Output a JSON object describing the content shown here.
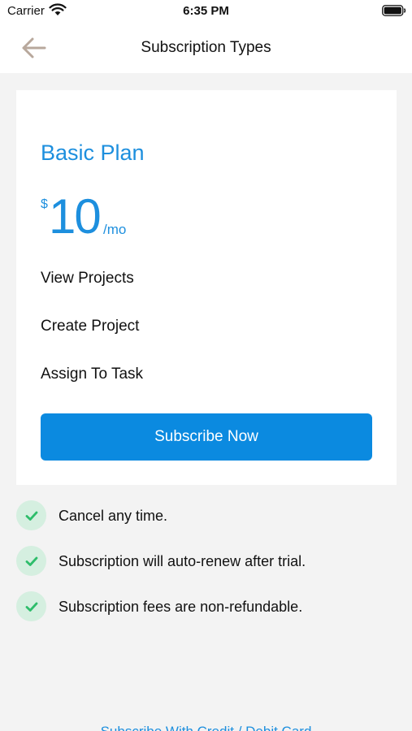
{
  "status_bar": {
    "carrier": "Carrier",
    "time": "6:35 PM",
    "icons": [
      "wifi-icon",
      "battery-icon"
    ]
  },
  "nav": {
    "back_icon": "arrow-left-icon",
    "title": "Subscription Types"
  },
  "plan": {
    "name": "Basic Plan",
    "currency": "$",
    "amount": "10",
    "period": "/mo",
    "features": [
      "View Projects",
      "Create Project",
      "Assign To Task"
    ],
    "cta_label": "Subscribe Now"
  },
  "notes": [
    "Cancel any time.",
    "Subscription will auto-renew after trial.",
    "Subscription fees are non-refundable."
  ],
  "bottom_link": "Subscribe With Credit / Debit Card",
  "colors": {
    "accent": "#1d8fde",
    "button": "#0b8ae0",
    "check_bg": "#d5efe0",
    "check": "#2ebd6b",
    "background": "#f3f3f3",
    "back_arrow": "#b8a89c"
  }
}
